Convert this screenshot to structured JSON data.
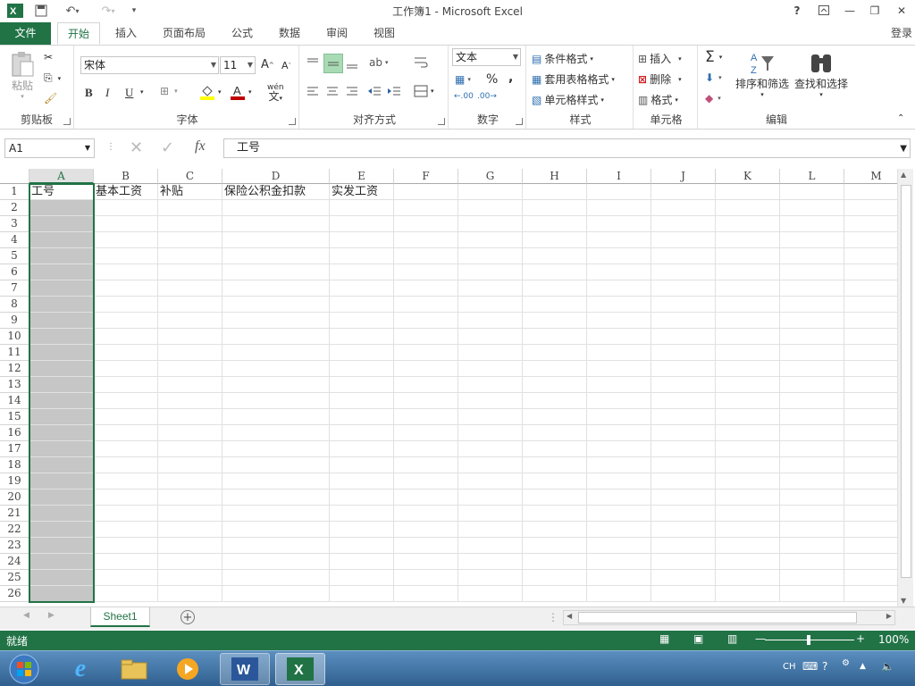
{
  "window": {
    "title": "工作簿1 - Microsoft Excel",
    "help_label": "?",
    "signin_label": "登录"
  },
  "tabs": [
    {
      "label": "文件"
    },
    {
      "label": "开始"
    },
    {
      "label": "插入"
    },
    {
      "label": "页面布局"
    },
    {
      "label": "公式"
    },
    {
      "label": "数据"
    },
    {
      "label": "审阅"
    },
    {
      "label": "视图"
    }
  ],
  "ribbon": {
    "clipboard": {
      "label": "剪贴板",
      "paste_label": "粘贴"
    },
    "font": {
      "label": "字体",
      "font_name": "宋体",
      "font_size": "11",
      "bold": "B",
      "italic": "I",
      "underline": "U",
      "wen": "wén"
    },
    "alignment": {
      "label": "对齐方式"
    },
    "number": {
      "label": "数字",
      "format": "文本",
      "percent": "%",
      "comma": ","
    },
    "styles": {
      "label": "样式",
      "conditional": "条件格式",
      "table_format": "套用表格格式",
      "cell_styles": "单元格样式"
    },
    "cells": {
      "label": "单元格",
      "insert": "插入",
      "delete": "删除",
      "format": "格式"
    },
    "editing": {
      "label": "编辑",
      "sort_filter": "排序和筛选",
      "find_select": "查找和选择"
    }
  },
  "formula_bar": {
    "name_box": "A1",
    "fx": "fx",
    "content": "工号"
  },
  "columns": [
    "A",
    "B",
    "C",
    "D",
    "E",
    "F",
    "G",
    "H",
    "I",
    "J",
    "K",
    "L",
    "M"
  ],
  "rows": [
    "1",
    "2",
    "3",
    "4",
    "5",
    "6",
    "7",
    "8",
    "9",
    "10",
    "11",
    "12",
    "13",
    "14",
    "15",
    "16",
    "17",
    "18",
    "19",
    "20",
    "21",
    "22",
    "23",
    "24",
    "25",
    "26"
  ],
  "cells": {
    "A1": "工号",
    "B1": "基本工资",
    "C1": "补贴",
    "D1": "保险公积金扣款",
    "E1": "实发工资"
  },
  "sheet_tabs": [
    "Sheet1"
  ],
  "status": {
    "ready": "就绪",
    "zoom": "100%"
  },
  "taskbar": {
    "lang": "CH"
  },
  "colors": {
    "accent": "#217346",
    "selection": "#c6c6c6"
  }
}
